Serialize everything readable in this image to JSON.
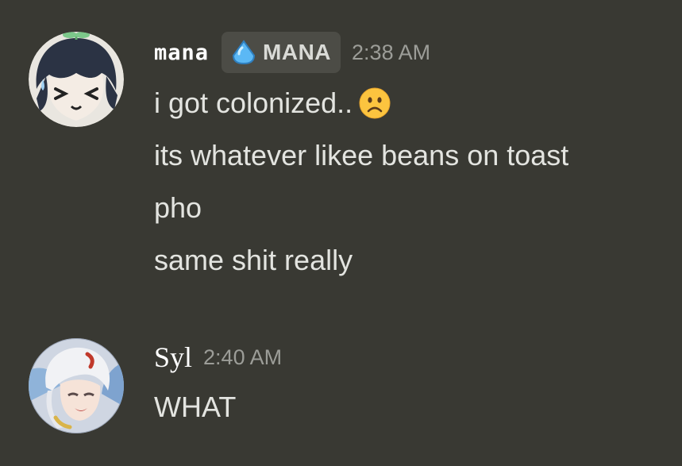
{
  "messages": [
    {
      "author": "mana",
      "tag": {
        "label": "MANA",
        "icon": "blue-droplet-icon",
        "color": "#5bb8f5"
      },
      "time": "2:38 AM",
      "avatar": "chibi-dark-hair-sprout-avatar",
      "lines": [
        "i got colonized..",
        "its whatever likee beans on toast",
        "pho",
        "same shit really"
      ],
      "emoji": "frowning-face-icon"
    },
    {
      "author": "Syl",
      "time": "2:40 AM",
      "avatar": "white-hair-character-avatar",
      "lines": [
        "WHAT"
      ]
    }
  ],
  "colors": {
    "background": "#393933",
    "text": "#e3e4e0",
    "timestamp": "#9c9d98",
    "tag_background": "#4c4c46"
  }
}
